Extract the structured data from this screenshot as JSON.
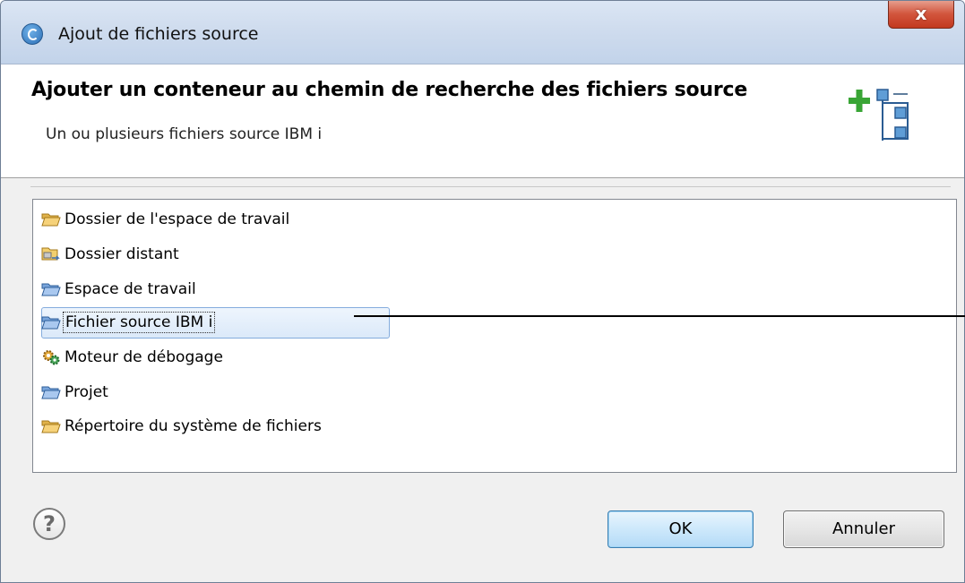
{
  "window": {
    "title": "Ajout de fichiers source",
    "close_label": "x"
  },
  "banner": {
    "heading": "Ajouter un conteneur au chemin de recherche des fichiers source",
    "subtitle": "Un ou plusieurs fichiers source IBM i",
    "icon": "add-container-icon"
  },
  "list": {
    "selected_index": 3,
    "items": [
      {
        "label": "Dossier de l'espace de travail",
        "icon": "folder-open-icon"
      },
      {
        "label": "Dossier distant",
        "icon": "remote-folder-icon"
      },
      {
        "label": "Espace de travail",
        "icon": "workspace-folder-icon"
      },
      {
        "label": "Fichier source IBM i",
        "icon": "source-file-folder-icon"
      },
      {
        "label": "Moteur de débogage",
        "icon": "debug-engine-icon"
      },
      {
        "label": "Projet",
        "icon": "project-folder-icon"
      },
      {
        "label": "Répertoire du système de fichiers",
        "icon": "filesystem-folder-icon"
      }
    ]
  },
  "buttons": {
    "ok": "OK",
    "cancel": "Annuler",
    "help_glyph": "?"
  },
  "colors": {
    "selection": "#dbe9f9",
    "selection_border": "#84acdd",
    "close_button": "#c8432a"
  }
}
